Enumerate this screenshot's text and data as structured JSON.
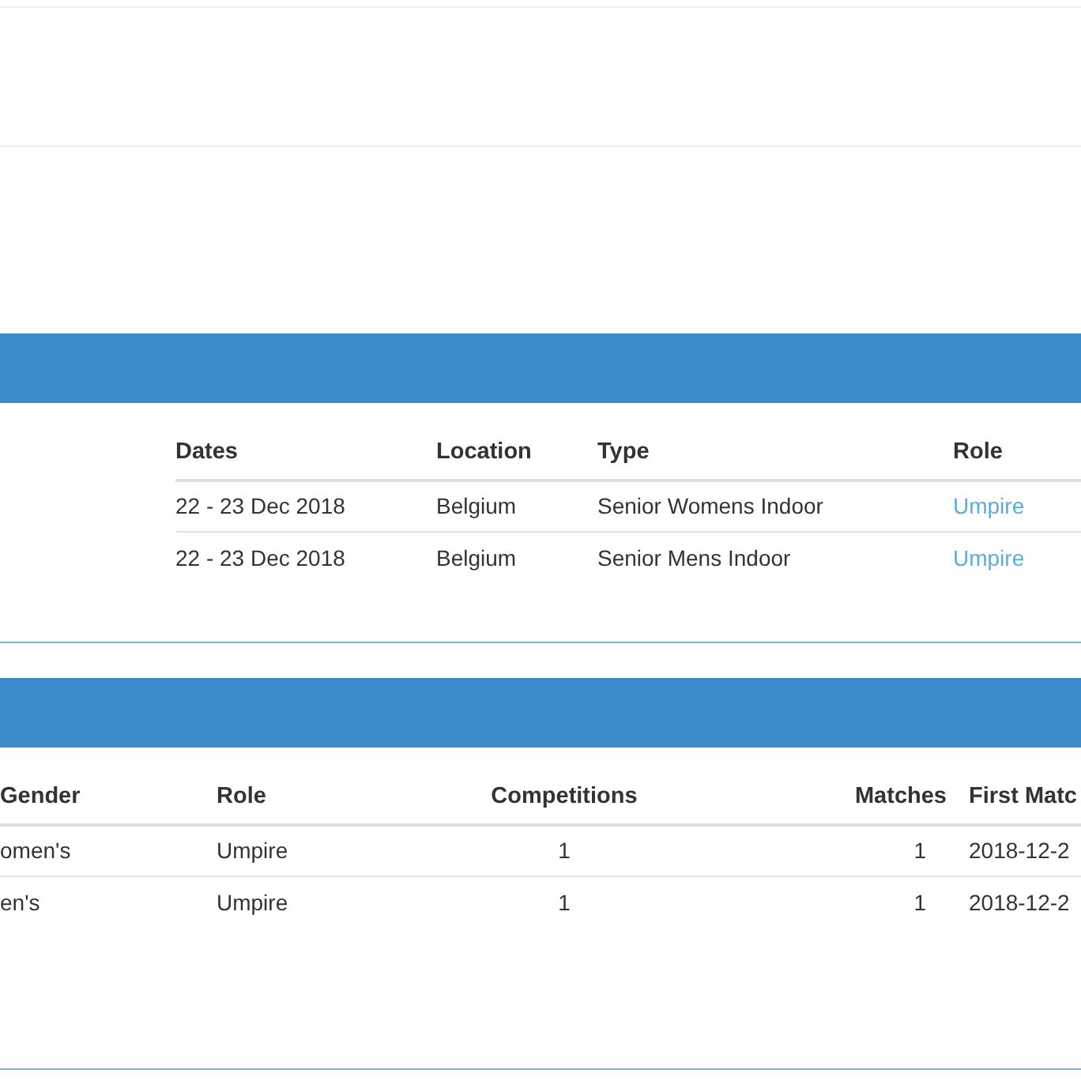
{
  "panels": [
    {
      "table": {
        "columns": [
          "Dates",
          "Location",
          "Type",
          "Role"
        ],
        "rows": [
          [
            {
              "kind": "text",
              "text": "22 - 23 Dec 2018"
            },
            {
              "kind": "text",
              "text": "Belgium"
            },
            {
              "kind": "text",
              "text": "Senior Womens Indoor"
            },
            {
              "kind": "link",
              "text": "Umpire"
            }
          ],
          [
            {
              "kind": "text",
              "text": "22 - 23 Dec 2018"
            },
            {
              "kind": "text",
              "text": "Belgium"
            },
            {
              "kind": "text",
              "text": "Senior Mens Indoor"
            },
            {
              "kind": "link",
              "text": "Umpire"
            }
          ]
        ]
      }
    },
    {
      "table": {
        "columns": [
          "Gender",
          "Role",
          "Competitions",
          "Matches",
          "First Matc"
        ],
        "rows": [
          [
            {
              "kind": "text",
              "text": "omen's"
            },
            {
              "kind": "text",
              "text": "Umpire"
            },
            {
              "kind": "text",
              "text": "1"
            },
            {
              "kind": "text",
              "text": "1"
            },
            {
              "kind": "text",
              "text": "2018-12-2"
            }
          ],
          [
            {
              "kind": "text",
              "text": "en's"
            },
            {
              "kind": "text",
              "text": "Umpire"
            },
            {
              "kind": "text",
              "text": "1"
            },
            {
              "kind": "text",
              "text": "1"
            },
            {
              "kind": "text",
              "text": "2018-12-2"
            }
          ]
        ]
      }
    }
  ]
}
